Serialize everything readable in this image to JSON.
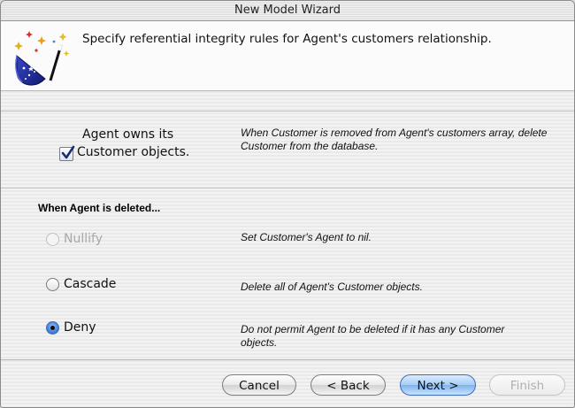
{
  "window": {
    "title": "New Model Wizard"
  },
  "header": {
    "instruction": "Specify referential integrity rules for Agent's customers relationship."
  },
  "ownership": {
    "checked": true,
    "label_line1": "Agent owns its",
    "label_line2": "Customer objects.",
    "description": "When Customer is removed from Agent's customers array, delete Customer from the database."
  },
  "delete_rule": {
    "heading": "When Agent is deleted...",
    "options": [
      {
        "label": "Nullify",
        "description": "Set Customer's Agent to nil.",
        "selected": false,
        "enabled": false
      },
      {
        "label": "Cascade",
        "description": "Delete all of Agent's Customer objects.",
        "selected": false,
        "enabled": true
      },
      {
        "label": "Deny",
        "description": "Do not permit Agent to be deleted if it has any Customer objects.",
        "selected": true,
        "enabled": true
      }
    ]
  },
  "buttons": {
    "cancel": "Cancel",
    "back": "< Back",
    "next": "Next >",
    "finish": "Finish"
  },
  "icons": {
    "wizard": "wizard-hat-wand-icon"
  }
}
